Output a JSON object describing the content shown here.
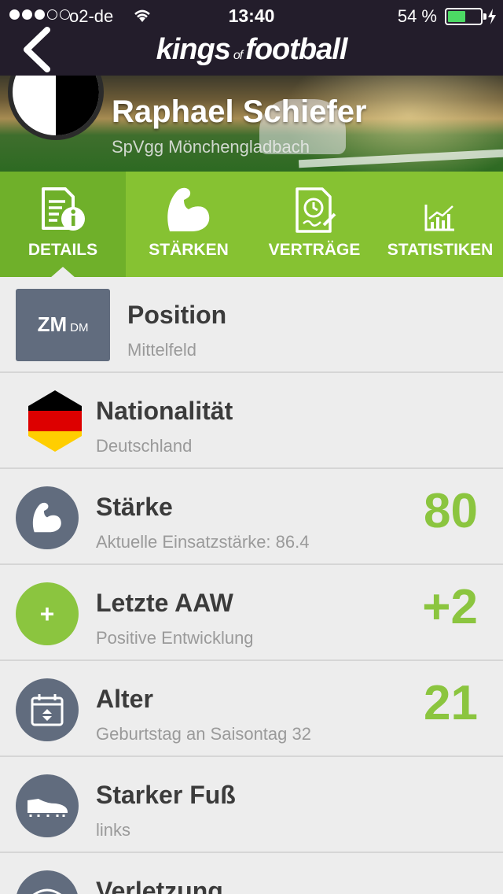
{
  "status_bar": {
    "carrier": "o2-de",
    "time": "13:40",
    "battery_percent": "54 %",
    "battery_level": 0.54,
    "signal_bars_filled": 3,
    "signal_bars_total": 5
  },
  "nav": {
    "back_icon": "chevron-left-icon",
    "logo_left": "kings",
    "logo_of": "of",
    "logo_right": "football"
  },
  "player": {
    "name": "Raphael Schiefer",
    "club": "SpVgg Mönchengladbach"
  },
  "tabs": [
    {
      "label": "DETAILS",
      "icon": "document-info-icon",
      "active": true
    },
    {
      "label": "STÄRKEN",
      "icon": "biceps-icon",
      "active": false
    },
    {
      "label": "VERTRÄGE",
      "icon": "contract-icon",
      "active": false
    },
    {
      "label": "STATISTIKEN",
      "icon": "chart-icon",
      "active": false
    }
  ],
  "details": {
    "position": {
      "badge_main": "ZM",
      "badge_secondary": "DM",
      "title": "Position",
      "subtitle": "Mittelfeld"
    },
    "nationality": {
      "title": "Nationalität",
      "subtitle": "Deutschland"
    },
    "strength": {
      "title": "Stärke",
      "subtitle": "Aktuelle Einsatzstärke: 86.4",
      "value": "80"
    },
    "last_aaw": {
      "icon_symbol": "+",
      "title": "Letzte AAW",
      "subtitle": "Positive Entwicklung",
      "value": "+2"
    },
    "age": {
      "title": "Alter",
      "subtitle": "Geburtstag an Saisontag 32",
      "value": "21"
    },
    "strong_foot": {
      "title": "Starker Fuß",
      "subtitle": "links"
    },
    "injury": {
      "title": "Verletzung"
    }
  },
  "colors": {
    "topbar": "#231d2b",
    "tab_bar": "#86c232",
    "tab_active": "#6fb02a",
    "value_green": "#8bc53f",
    "icon_circle": "#616c7e",
    "flag_black": "#000000",
    "flag_red": "#dd0000",
    "flag_gold": "#ffce00"
  }
}
